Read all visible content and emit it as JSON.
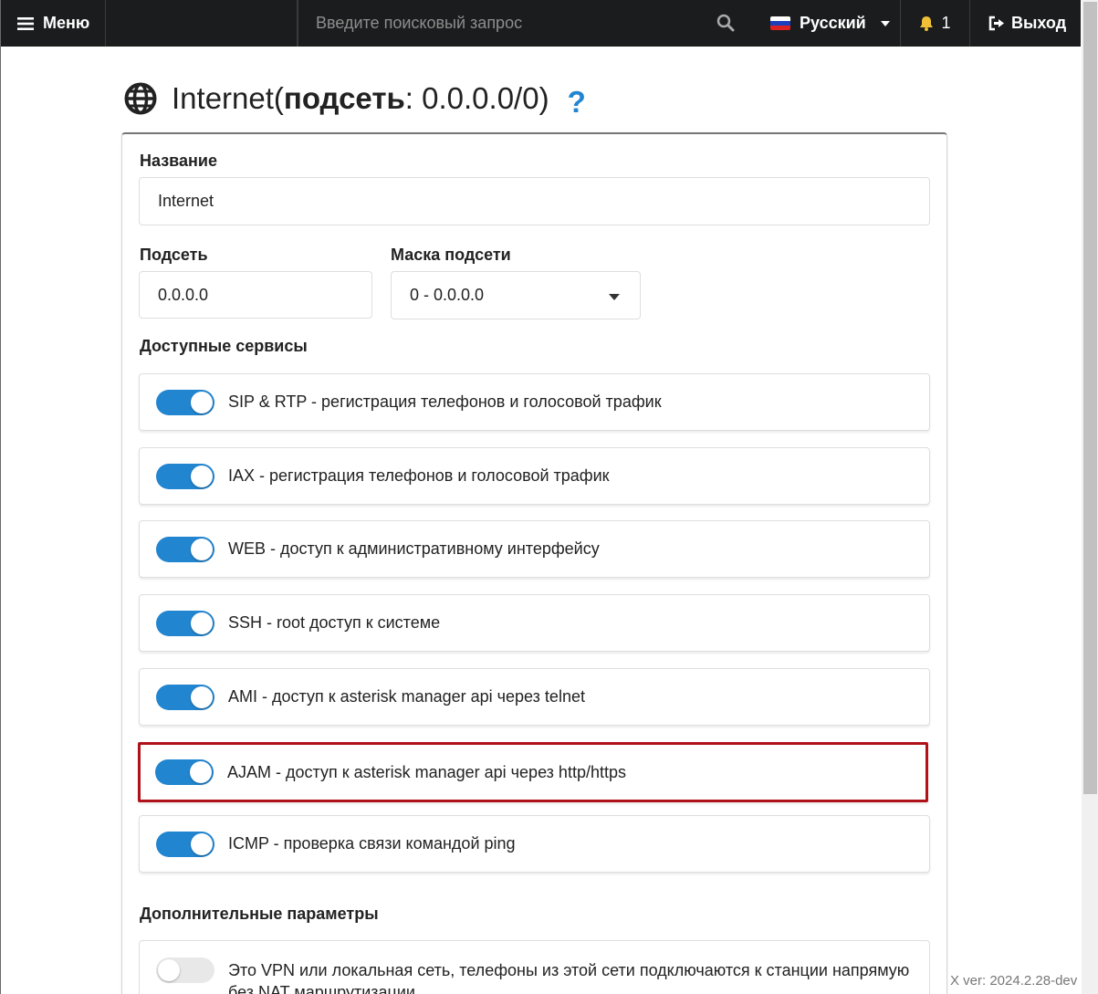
{
  "topbar": {
    "menu_label": "Меню",
    "search_placeholder": "Введите поисковый запрос",
    "language": "Русский",
    "notifications_count": "1",
    "logout_label": "Выход"
  },
  "page": {
    "title_name": "Internet(",
    "title_subnet_label": "подсеть",
    "title_rest": ": 0.0.0.0/0)",
    "help_glyph": "?"
  },
  "form": {
    "name_label": "Название",
    "name_value": "Internet",
    "subnet_label": "Подсеть",
    "subnet_value": "0.0.0.0",
    "mask_label": "Маска подсети",
    "mask_value": "0 - 0.0.0.0",
    "services_label": "Доступные сервисы",
    "services": [
      {
        "label": "SIP & RTP - регистрация телефонов и голосовой трафик",
        "enabled": true
      },
      {
        "label": "IAX - регистрация телефонов и голосовой трафик",
        "enabled": true
      },
      {
        "label": "WEB - доступ к административному интерфейсу",
        "enabled": true
      },
      {
        "label": "SSH - root доступ к системе",
        "enabled": true
      },
      {
        "label": "AMI - доступ к asterisk manager api через telnet",
        "enabled": true
      },
      {
        "label": "AJAM - доступ к asterisk manager api через http/https",
        "enabled": true
      },
      {
        "label": "ICMP - проверка связи командой ping",
        "enabled": true
      }
    ],
    "advanced_label": "Дополнительные параметры",
    "advanced_option": {
      "label": "Это VPN или локальная сеть, телефоны из этой сети подключаются к станции напрямую без NAT маршрутизации",
      "enabled": false
    }
  },
  "footer": {
    "version": "X ver: 2024.2.28-dev"
  },
  "colors": {
    "accent": "#2185d0",
    "highlight_border": "#b0121a",
    "topbar_bg": "#1b1c1d"
  }
}
